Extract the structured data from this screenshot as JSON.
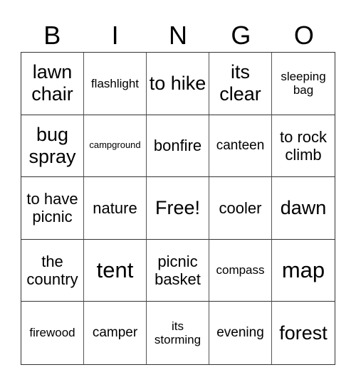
{
  "header": {
    "letters": [
      "B",
      "I",
      "N",
      "G",
      "O"
    ]
  },
  "grid": {
    "cells": [
      "lawn chair",
      "flashlight",
      "to hike",
      "its clear",
      "sleeping bag",
      "bug spray",
      "campground",
      "bonfire",
      "canteen",
      "to rock climb",
      "to have picnic",
      "nature",
      "Free!",
      "cooler",
      "dawn",
      "the country",
      "tent",
      "picnic basket",
      "compass",
      "map",
      "firewood",
      "camper",
      "its storming",
      "evening",
      "forest"
    ]
  }
}
